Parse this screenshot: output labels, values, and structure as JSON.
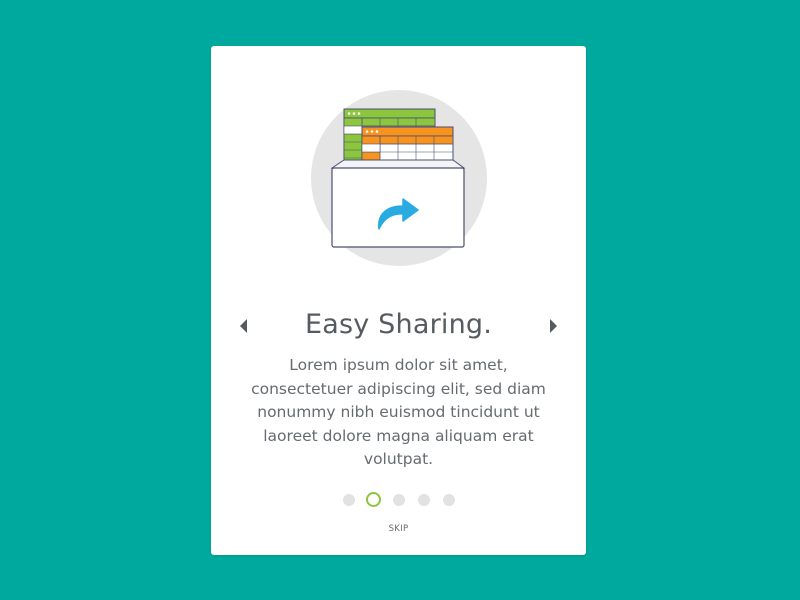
{
  "slide": {
    "title": "Easy Sharing.",
    "description": "Lorem ipsum dolor sit amet, consectetuer adipiscing elit, sed diam nonummy nibh euismod tincidunt ut laoreet dolore magna aliquam erat volutpat."
  },
  "navigation": {
    "prev_icon": "caret-left-icon",
    "next_icon": "caret-right-icon"
  },
  "pagination": {
    "total": 5,
    "active_index": 1
  },
  "skip_label": "SKIP",
  "colors": {
    "background": "#00A99D",
    "card": "#FFFFFF",
    "accent_green": "#8CC63F",
    "accent_orange": "#F7931E",
    "accent_blue": "#29ABE2",
    "text": "#555B61"
  },
  "illustration": {
    "icons": [
      "folder-icon",
      "spreadsheet-green-icon",
      "spreadsheet-orange-icon",
      "share-arrow-icon"
    ]
  }
}
